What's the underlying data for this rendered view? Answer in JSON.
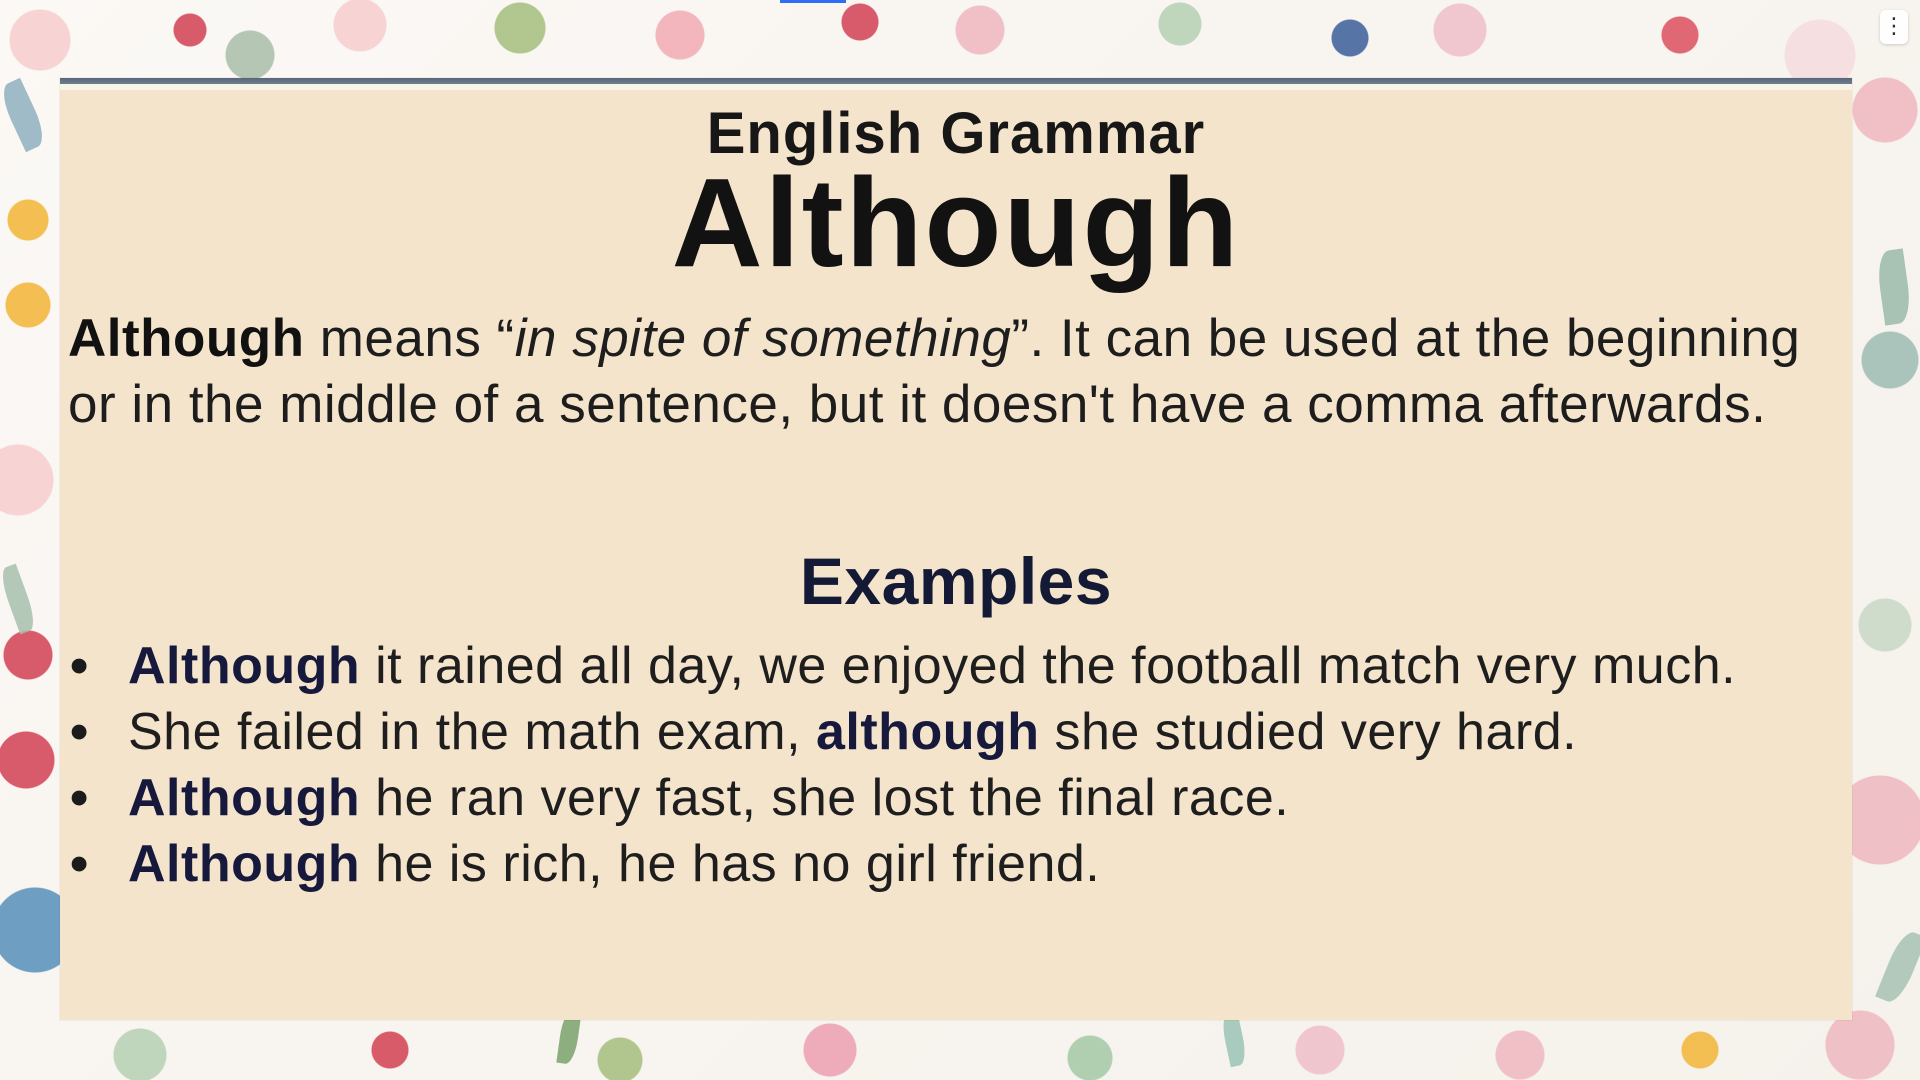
{
  "slide": {
    "title_small": "English Grammar",
    "title_big": "Although",
    "definition": {
      "lead": "Although",
      "text_1": " means “",
      "quote": "in spite of something",
      "text_2": "”. It  can be used at the beginning or in the middle of a sentence, but it doesn't have a comma afterwards."
    },
    "examples_title": "Examples",
    "examples": [
      {
        "bullet": "•",
        "part1": "Although",
        "part2": " it rained all day, we enjoyed the football match very much."
      },
      {
        "bullet": "•",
        "part1": "She failed in the math exam, ",
        "part2": "although",
        "part3": " she studied very hard."
      },
      {
        "bullet": "•",
        "part1": "Although",
        "part2": " he ran very fast, she lost the final race."
      },
      {
        "bullet": "•",
        "part1": "Although",
        "part2": " he is rich, he has no girl friend."
      }
    ]
  },
  "controls": {
    "menu_label": "⋮"
  },
  "colors": {
    "panel": "#f4e4cb",
    "rule": "#5f6c80",
    "title": "#121212",
    "keyword": "#16193b",
    "progress": "#2d6ef5"
  },
  "icons": {
    "menu": "vertical-ellipsis-icon",
    "bullet": "bullet-dot-icon"
  }
}
